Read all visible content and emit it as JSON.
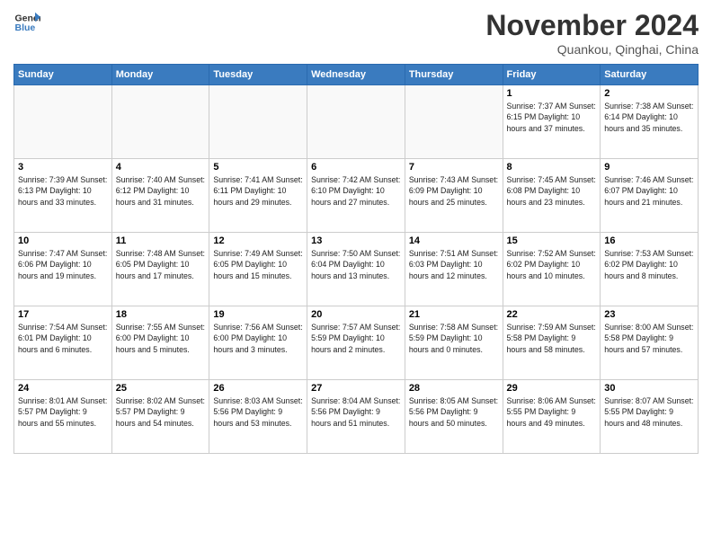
{
  "logo": {
    "line1": "General",
    "line2": "Blue"
  },
  "title": "November 2024",
  "location": "Quankou, Qinghai, China",
  "days": [
    "Sunday",
    "Monday",
    "Tuesday",
    "Wednesday",
    "Thursday",
    "Friday",
    "Saturday"
  ],
  "weeks": [
    [
      {
        "date": "",
        "text": ""
      },
      {
        "date": "",
        "text": ""
      },
      {
        "date": "",
        "text": ""
      },
      {
        "date": "",
        "text": ""
      },
      {
        "date": "",
        "text": ""
      },
      {
        "date": "1",
        "text": "Sunrise: 7:37 AM\nSunset: 6:15 PM\nDaylight: 10 hours\nand 37 minutes."
      },
      {
        "date": "2",
        "text": "Sunrise: 7:38 AM\nSunset: 6:14 PM\nDaylight: 10 hours\nand 35 minutes."
      }
    ],
    [
      {
        "date": "3",
        "text": "Sunrise: 7:39 AM\nSunset: 6:13 PM\nDaylight: 10 hours\nand 33 minutes."
      },
      {
        "date": "4",
        "text": "Sunrise: 7:40 AM\nSunset: 6:12 PM\nDaylight: 10 hours\nand 31 minutes."
      },
      {
        "date": "5",
        "text": "Sunrise: 7:41 AM\nSunset: 6:11 PM\nDaylight: 10 hours\nand 29 minutes."
      },
      {
        "date": "6",
        "text": "Sunrise: 7:42 AM\nSunset: 6:10 PM\nDaylight: 10 hours\nand 27 minutes."
      },
      {
        "date": "7",
        "text": "Sunrise: 7:43 AM\nSunset: 6:09 PM\nDaylight: 10 hours\nand 25 minutes."
      },
      {
        "date": "8",
        "text": "Sunrise: 7:45 AM\nSunset: 6:08 PM\nDaylight: 10 hours\nand 23 minutes."
      },
      {
        "date": "9",
        "text": "Sunrise: 7:46 AM\nSunset: 6:07 PM\nDaylight: 10 hours\nand 21 minutes."
      }
    ],
    [
      {
        "date": "10",
        "text": "Sunrise: 7:47 AM\nSunset: 6:06 PM\nDaylight: 10 hours\nand 19 minutes."
      },
      {
        "date": "11",
        "text": "Sunrise: 7:48 AM\nSunset: 6:05 PM\nDaylight: 10 hours\nand 17 minutes."
      },
      {
        "date": "12",
        "text": "Sunrise: 7:49 AM\nSunset: 6:05 PM\nDaylight: 10 hours\nand 15 minutes."
      },
      {
        "date": "13",
        "text": "Sunrise: 7:50 AM\nSunset: 6:04 PM\nDaylight: 10 hours\nand 13 minutes."
      },
      {
        "date": "14",
        "text": "Sunrise: 7:51 AM\nSunset: 6:03 PM\nDaylight: 10 hours\nand 12 minutes."
      },
      {
        "date": "15",
        "text": "Sunrise: 7:52 AM\nSunset: 6:02 PM\nDaylight: 10 hours\nand 10 minutes."
      },
      {
        "date": "16",
        "text": "Sunrise: 7:53 AM\nSunset: 6:02 PM\nDaylight: 10 hours\nand 8 minutes."
      }
    ],
    [
      {
        "date": "17",
        "text": "Sunrise: 7:54 AM\nSunset: 6:01 PM\nDaylight: 10 hours\nand 6 minutes."
      },
      {
        "date": "18",
        "text": "Sunrise: 7:55 AM\nSunset: 6:00 PM\nDaylight: 10 hours\nand 5 minutes."
      },
      {
        "date": "19",
        "text": "Sunrise: 7:56 AM\nSunset: 6:00 PM\nDaylight: 10 hours\nand 3 minutes."
      },
      {
        "date": "20",
        "text": "Sunrise: 7:57 AM\nSunset: 5:59 PM\nDaylight: 10 hours\nand 2 minutes."
      },
      {
        "date": "21",
        "text": "Sunrise: 7:58 AM\nSunset: 5:59 PM\nDaylight: 10 hours\nand 0 minutes."
      },
      {
        "date": "22",
        "text": "Sunrise: 7:59 AM\nSunset: 5:58 PM\nDaylight: 9 hours\nand 58 minutes."
      },
      {
        "date": "23",
        "text": "Sunrise: 8:00 AM\nSunset: 5:58 PM\nDaylight: 9 hours\nand 57 minutes."
      }
    ],
    [
      {
        "date": "24",
        "text": "Sunrise: 8:01 AM\nSunset: 5:57 PM\nDaylight: 9 hours\nand 55 minutes."
      },
      {
        "date": "25",
        "text": "Sunrise: 8:02 AM\nSunset: 5:57 PM\nDaylight: 9 hours\nand 54 minutes."
      },
      {
        "date": "26",
        "text": "Sunrise: 8:03 AM\nSunset: 5:56 PM\nDaylight: 9 hours\nand 53 minutes."
      },
      {
        "date": "27",
        "text": "Sunrise: 8:04 AM\nSunset: 5:56 PM\nDaylight: 9 hours\nand 51 minutes."
      },
      {
        "date": "28",
        "text": "Sunrise: 8:05 AM\nSunset: 5:56 PM\nDaylight: 9 hours\nand 50 minutes."
      },
      {
        "date": "29",
        "text": "Sunrise: 8:06 AM\nSunset: 5:55 PM\nDaylight: 9 hours\nand 49 minutes."
      },
      {
        "date": "30",
        "text": "Sunrise: 8:07 AM\nSunset: 5:55 PM\nDaylight: 9 hours\nand 48 minutes."
      }
    ]
  ]
}
